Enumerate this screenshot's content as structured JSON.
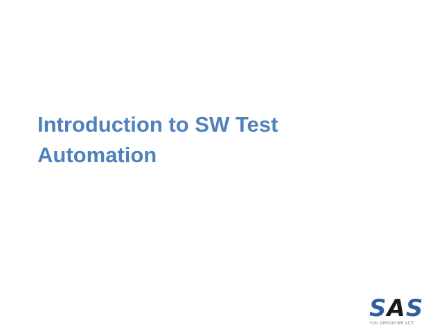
{
  "slide": {
    "title_line1": "Introduction to SW Test",
    "title_line2": "Automation",
    "title_color": "#4f81bd"
  },
  "logo": {
    "letters": [
      "S",
      "A",
      "S"
    ],
    "tagline": "YOU DREAM WE ACT",
    "colors": {
      "primary": "#2f5d9e",
      "secondary": "#1a1a1a"
    }
  }
}
